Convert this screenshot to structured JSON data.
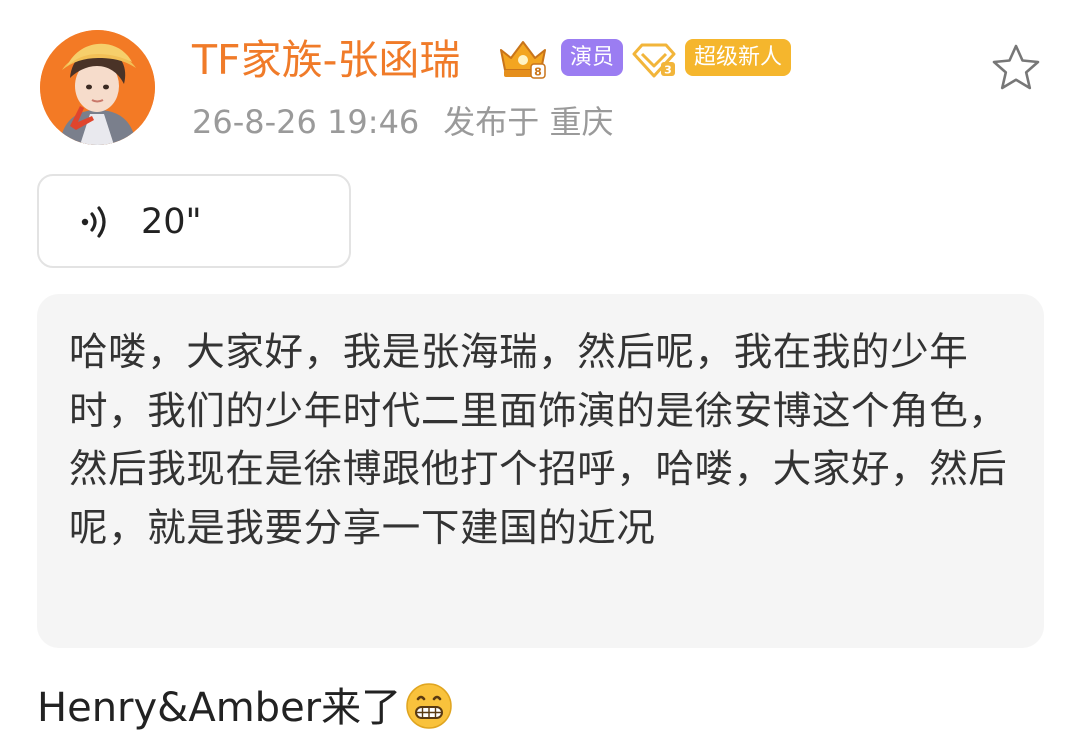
{
  "post": {
    "username": "TF家族-张函瑞",
    "role_badge": "演员",
    "new_badge": "超级新人",
    "timestamp": "26-8-26 19:46",
    "location": "发布于 重庆"
  },
  "voice": {
    "duration": "20\""
  },
  "transcript": {
    "text": "哈喽，大家好，我是张海瑞，然后呢，我在我的少年时，我们的少年时代二里面饰演的是徐安博这个角色，然后我现在是徐博跟他打个招呼，哈喽，大家好，然后呢，就是我要分享一下建国的近况"
  },
  "body": {
    "text": "Henry&Amber来了"
  },
  "icons": {
    "favorite": "star-outline-icon",
    "voice": "sound-wave-icon",
    "emoji": "grinning-face-emoji",
    "crown": "crown-badge-icon",
    "diamond": "diamond-level-icon"
  },
  "colors": {
    "username": "#f07b29",
    "role_badge": "#9b7df2",
    "new_badge": "#f5b62d",
    "meta": "#9a9a9a",
    "transcript_bg": "#f5f5f5"
  }
}
